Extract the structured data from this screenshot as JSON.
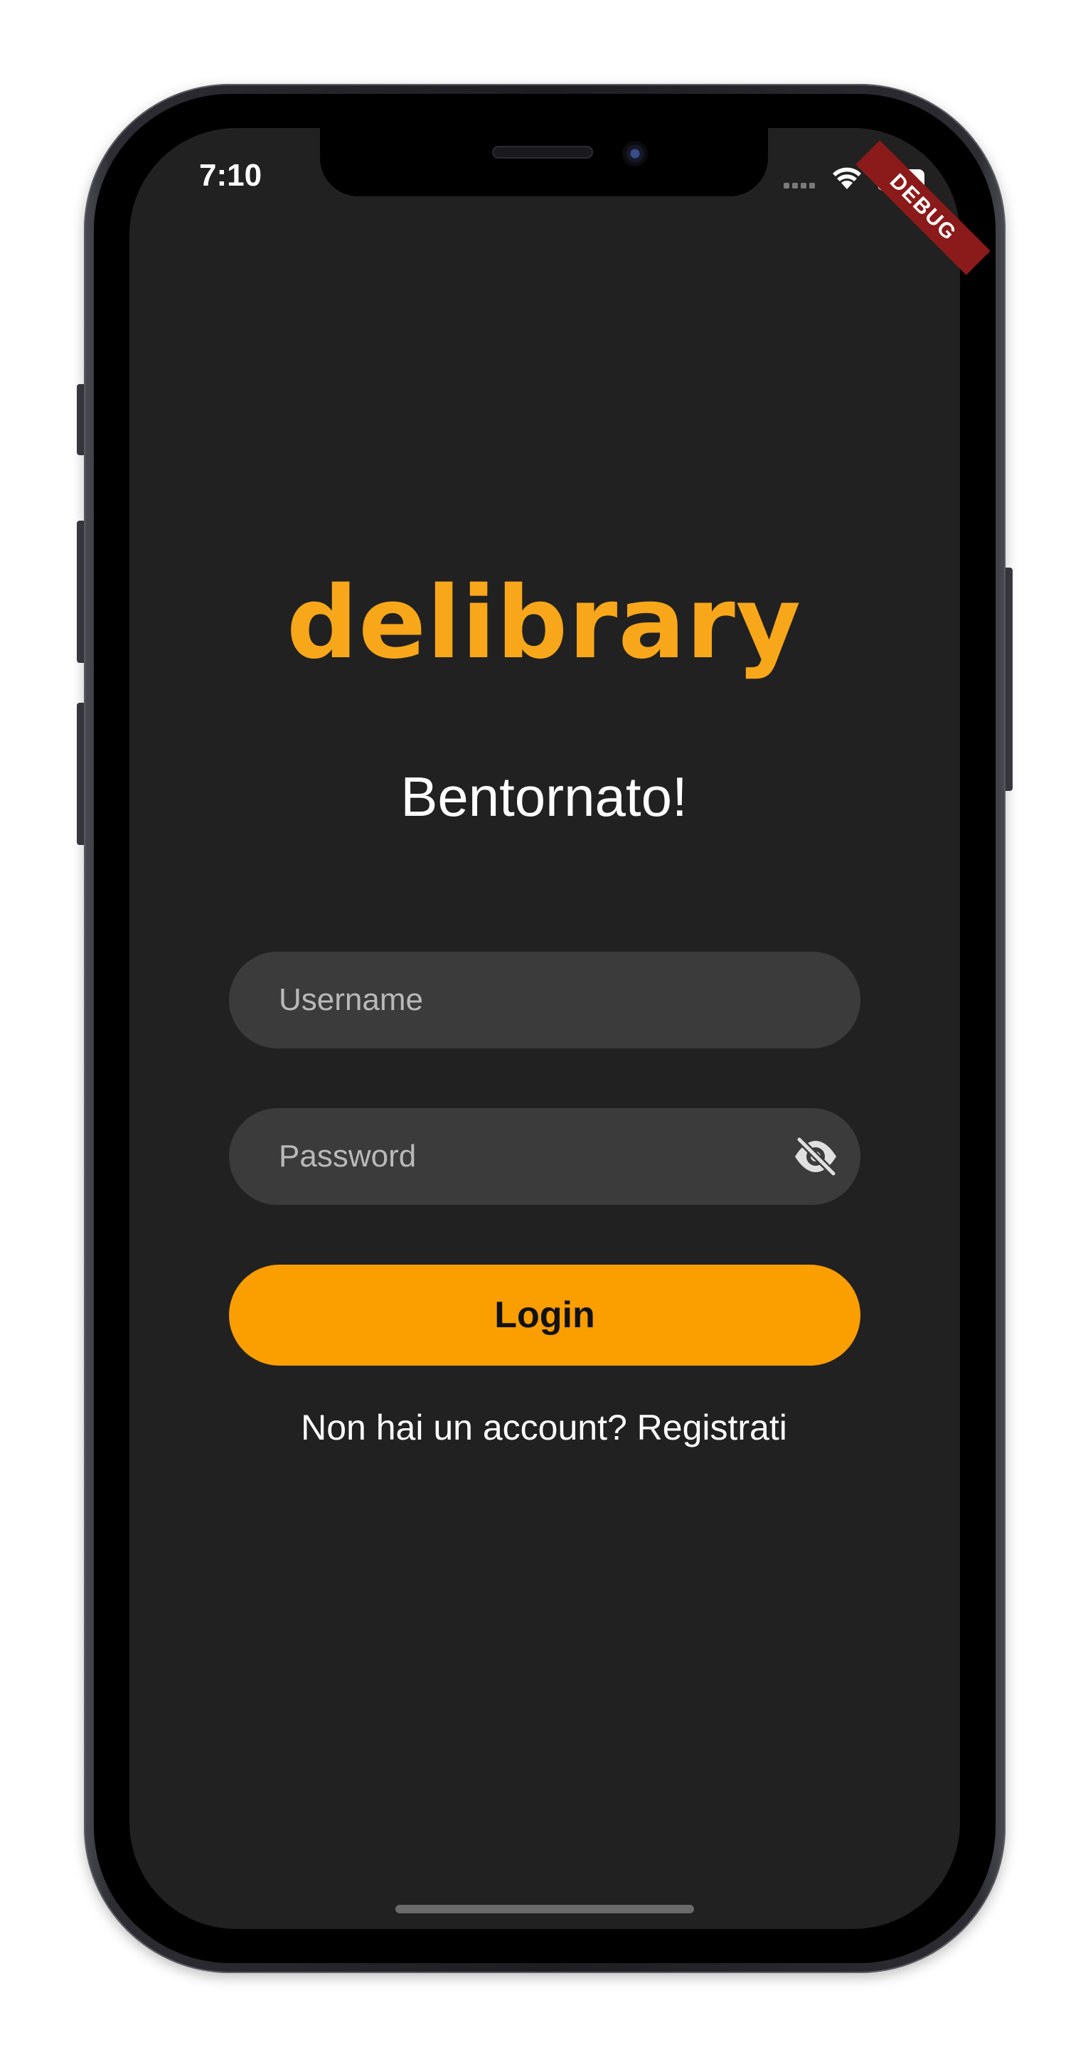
{
  "status_bar": {
    "time": "7:10"
  },
  "debug_banner": "DEBUG",
  "app": {
    "logo_text": "delibrary",
    "welcome_text": "Bentornato!",
    "username": {
      "value": "",
      "placeholder": "Username"
    },
    "password": {
      "value": "",
      "placeholder": "Password",
      "toggle_icon": "eye-off-icon"
    },
    "login_label": "Login",
    "register_text": "Non hai un account? Registrati"
  },
  "colors": {
    "background": "#212121",
    "accent": "#fb9e00",
    "logo": "#f9a71a",
    "field": "#3b3b3b",
    "debug": "#8b1a1a"
  }
}
